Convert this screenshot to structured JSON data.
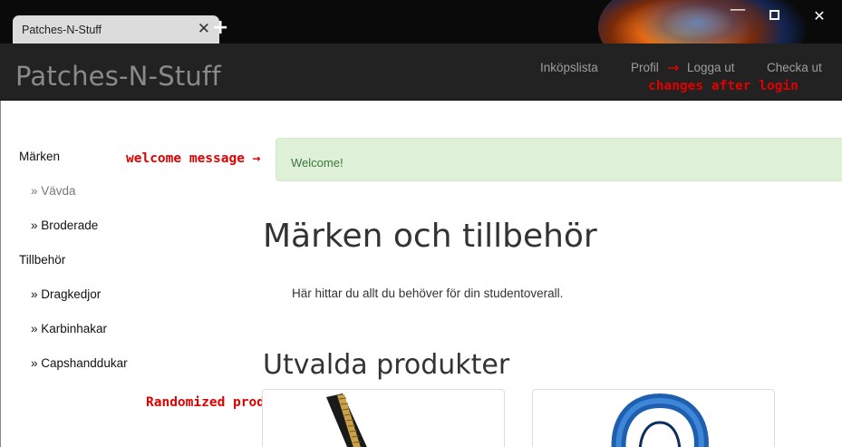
{
  "browser": {
    "tab_title": "Patches-N-Stuff",
    "tab_close": "✕",
    "new_tab": "+",
    "controls": {
      "minimize": "—",
      "maximize": "",
      "close": "✕"
    }
  },
  "navbar": {
    "brand": "Patches-N-Stuff",
    "links": {
      "cart": "Inköpslista",
      "profile": "Profil",
      "logout": "Logga ut",
      "checkout": "Checka ut"
    }
  },
  "annotations": {
    "login": "changes after login",
    "welcome": "welcome message →",
    "products": "Randomized products →",
    "nav_arrow": "→"
  },
  "sidebar": {
    "categories": [
      {
        "label": "Märken",
        "items": [
          "» Vävda",
          "» Broderade"
        ]
      },
      {
        "label": "Tillbehör",
        "items": [
          "» Dragkedjor",
          "» Karbinhakar",
          "» Capshanddukar"
        ]
      }
    ]
  },
  "alert": {
    "message": "Welcome!"
  },
  "main": {
    "heading": "Märken och tillbehör",
    "lead": "Här hittar du allt du behöver för din studentoverall.",
    "featured_heading": "Utvalda produkter"
  },
  "products": [
    {
      "image": "zipper"
    },
    {
      "image": "carabiner"
    }
  ],
  "colors": {
    "navbar_bg": "#222222",
    "alert_bg": "#dff0d8",
    "alert_text": "#3c763d",
    "annotation": "#e00000"
  }
}
